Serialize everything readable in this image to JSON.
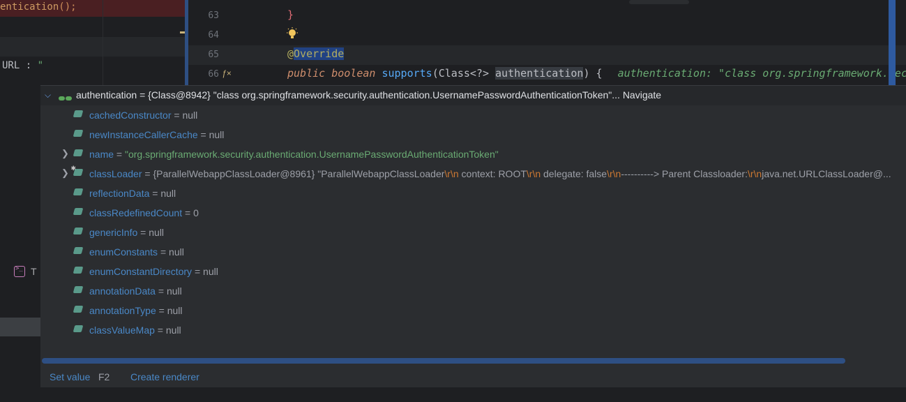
{
  "left_editor": {
    "line1_prefix": "entication",
    "line1_suffix": "();",
    "url_prefix": "URL : ",
    "url_string": "\"",
    "terminal_label": "T"
  },
  "code": {
    "line_numbers": [
      "63",
      "64",
      "65",
      "66"
    ],
    "close_brace": "}",
    "annotation_at": "@",
    "annotation_name": "Override",
    "kw_public": "public",
    "kw_boolean": "boolean",
    "method_name": "supports",
    "param_type": "Class<?>",
    "param_name": "authentication",
    "sig_close": ") {",
    "inline_hint": "authentication: \"class org.springframework.security.authe"
  },
  "popup": {
    "title": "authentication = {Class@8942} \"class org.springframework.security.authentication.UsernamePasswordAuthenticationToken\"...",
    "navigate": "Navigate",
    "fields": [
      {
        "name": "cachedConstructor",
        "value": "null",
        "expandable": false,
        "static": false
      },
      {
        "name": "newInstanceCallerCache",
        "value": "null",
        "expandable": false,
        "static": false
      },
      {
        "name": "name",
        "value": "\"org.springframework.security.authentication.UsernamePasswordAuthenticationToken\"",
        "expandable": true,
        "static": false,
        "is_string": true
      },
      {
        "name": "classLoader",
        "value_parts": [
          "{ParallelWebappClassLoader@8961} \"ParallelWebappClassLoader",
          "\\r\\n",
          "  context: ROOT",
          "\\r\\n",
          "  delegate: false",
          "\\r\\n",
          "----------> Parent Classloader:",
          "\\r\\n",
          "java.net.URLClassLoader@..."
        ],
        "expandable": true,
        "static": true
      },
      {
        "name": "reflectionData",
        "value": "null",
        "expandable": false,
        "static": false
      },
      {
        "name": "classRedefinedCount",
        "value": "0",
        "expandable": false,
        "static": false
      },
      {
        "name": "genericInfo",
        "value": "null",
        "expandable": false,
        "static": false
      },
      {
        "name": "enumConstants",
        "value": "null",
        "expandable": false,
        "static": false
      },
      {
        "name": "enumConstantDirectory",
        "value": "null",
        "expandable": false,
        "static": false
      },
      {
        "name": "annotationData",
        "value": "null",
        "expandable": false,
        "static": false
      },
      {
        "name": "annotationType",
        "value": "null",
        "expandable": false,
        "static": false
      },
      {
        "name": "classValueMap",
        "value": "null",
        "expandable": false,
        "static": false
      }
    ],
    "footer": {
      "set_value": "Set value",
      "set_value_key": "F2",
      "create_renderer": "Create renderer"
    }
  },
  "colors": {
    "field_name": "#4a88c7",
    "string_value": "#6aab73",
    "escape": "#cc7832",
    "accent_blue": "#2e5aa0"
  },
  "icons": [
    "expand-chevron-icon",
    "watch-glasses-icon",
    "field-tag-icon",
    "chevron-right-icon",
    "lightbulb-icon",
    "override-method-icon",
    "terminal-icon"
  ]
}
